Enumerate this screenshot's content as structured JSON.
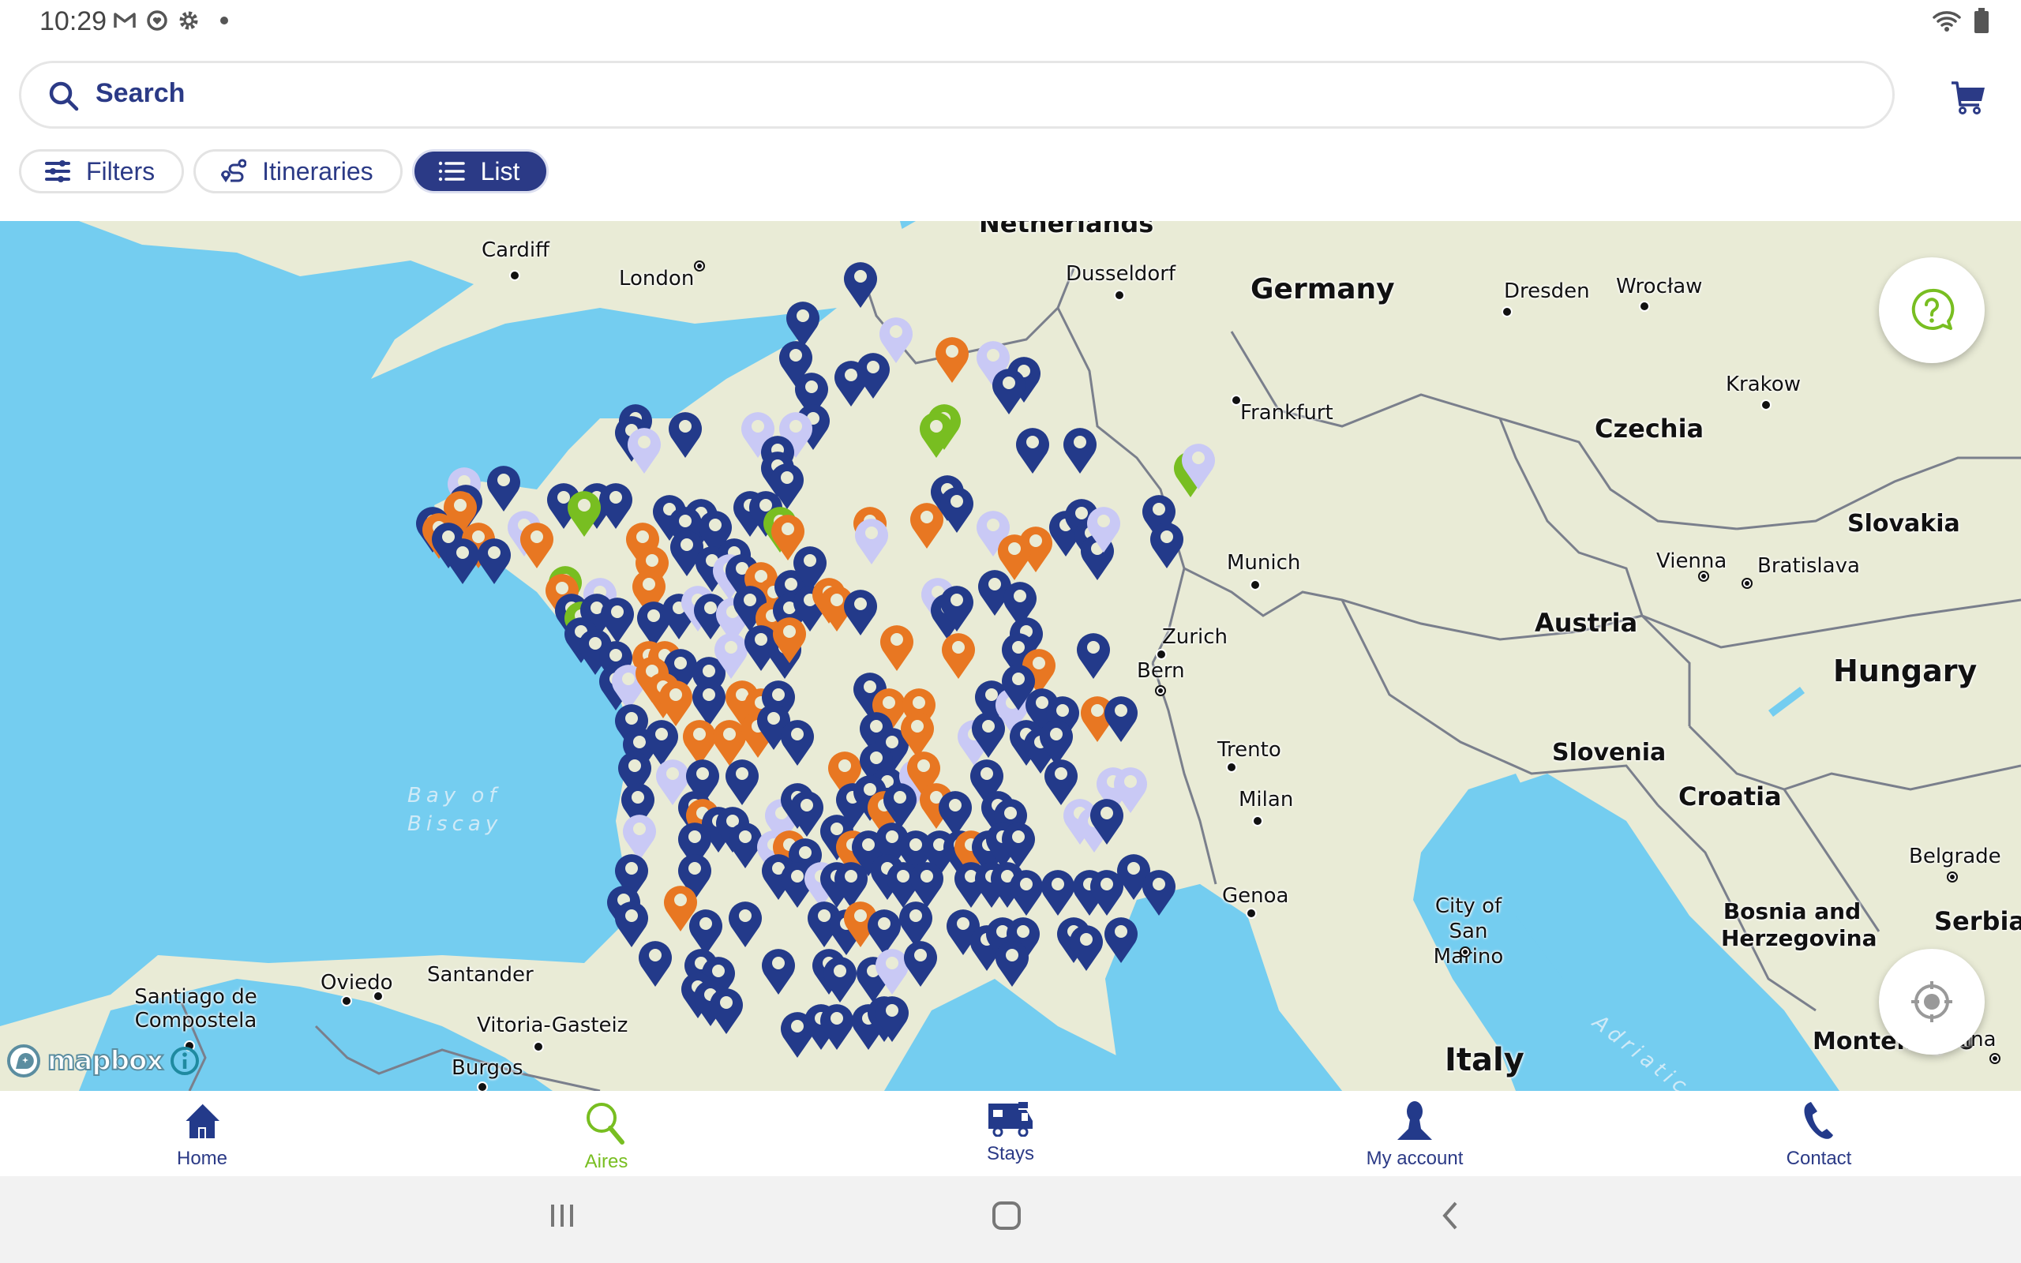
{
  "status_bar": {
    "time": "10:29",
    "left_icons": [
      "gmail-icon",
      "heart-circle-icon",
      "settings-gear-icon",
      "notification-dot-icon"
    ],
    "right_icons": [
      "wifi-icon",
      "battery-icon"
    ]
  },
  "search": {
    "placeholder": "Search",
    "icon": "search-icon"
  },
  "header": {
    "cart_icon": "cart-icon"
  },
  "chips": [
    {
      "label": "Filters",
      "icon": "sliders-icon",
      "active": false
    },
    {
      "label": "Itineraries",
      "icon": "route-icon",
      "active": false
    },
    {
      "label": "List",
      "icon": "list-icon",
      "active": true
    }
  ],
  "map": {
    "attribution": "mapbox",
    "help_button_icon": "help-chat-icon",
    "locate_button_icon": "crosshair-locate-icon",
    "colors": {
      "water": "#74CDF0",
      "land": "#E9EBD6",
      "border": "#7A7F8C",
      "pin_navy": "#233A8A",
      "pin_lavender": "#C9C9F5",
      "pin_orange": "#E87722",
      "pin_green": "#78BE21"
    },
    "pin_categories": [
      "navy",
      "lavender",
      "orange",
      "green"
    ],
    "country_labels": [
      "Germany",
      "Czechia",
      "Slovakia",
      "Austria",
      "Hungary",
      "Slovenia",
      "Croatia",
      "Italy",
      "Bosnia and Herzegovina",
      "Serbia",
      "Montenegro"
    ],
    "city_labels": [
      "Cardiff",
      "London",
      "Dusseldorf",
      "Frankfurt",
      "Dresden",
      "Wrocław",
      "Krakow",
      "Munich",
      "Vienna",
      "Bratislava",
      "Zurich",
      "Bern",
      "Trento",
      "Milan",
      "Genoa",
      "City of San Marino",
      "Belgrade",
      "Pristina",
      "Santiago de Compostela",
      "Oviedo",
      "Santander",
      "Vitoria-Gasteiz",
      "Burgos",
      "Netherlands"
    ],
    "sea_labels": [
      "Bay of Biscay",
      "Adriatic Sea"
    ]
  },
  "bottom_nav": [
    {
      "label": "Home",
      "icon": "home-icon",
      "active": false
    },
    {
      "label": "Aires",
      "icon": "search-icon",
      "active": true
    },
    {
      "label": "Stays",
      "icon": "camper-van-icon",
      "active": false
    },
    {
      "label": "My account",
      "icon": "user-icon",
      "active": false
    },
    {
      "label": "Contact",
      "icon": "phone-icon",
      "active": false
    }
  ],
  "system_nav": [
    "recents-button",
    "home-button",
    "back-button"
  ]
}
